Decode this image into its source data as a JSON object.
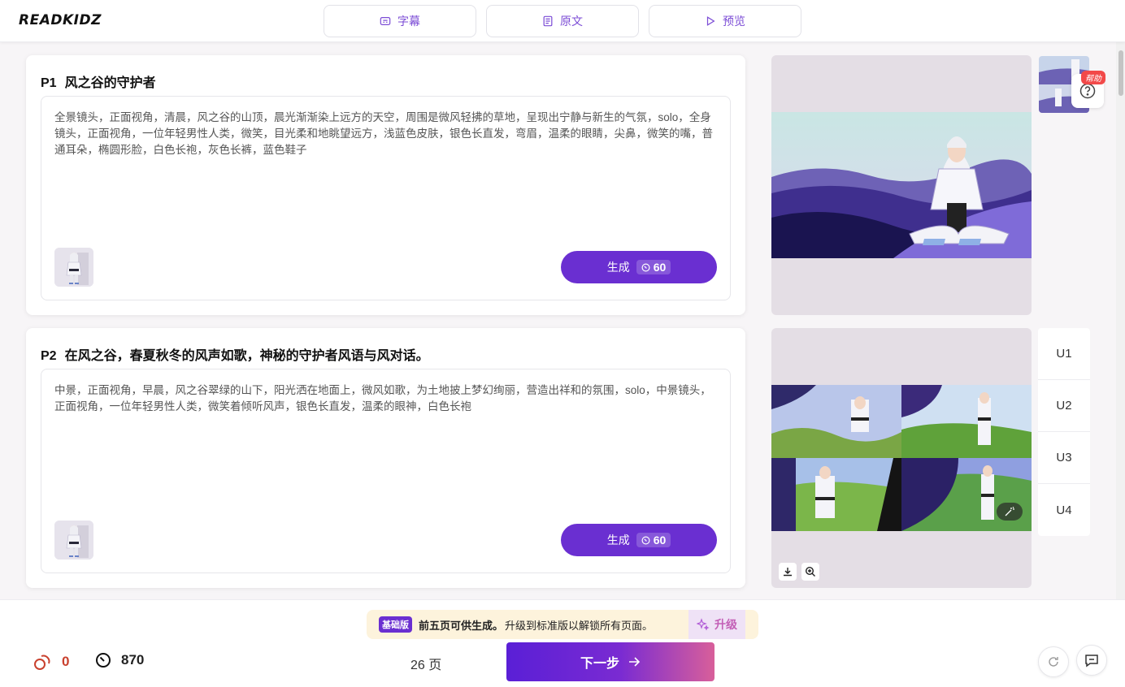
{
  "header": {
    "logo": "READKIDZ",
    "tabs": [
      {
        "label": "字幕",
        "icon": "subtitles-icon"
      },
      {
        "label": "原文",
        "icon": "document-icon"
      },
      {
        "label": "预览",
        "icon": "play-icon"
      }
    ]
  },
  "pages": [
    {
      "number": "P1",
      "title": "风之谷的守护者",
      "prompt": "全景镜头，正面视角，清晨，风之谷的山顶，晨光渐渐染上远方的天空，周围是微风轻拂的草地，呈现出宁静与新生的气氛，solo，全身镜头，正面视角，一位年轻男性人类，微笑，目光柔和地眺望远方，浅蓝色皮肤，银色长直发，弯眉，温柔的眼睛，尖鼻，微笑的嘴，普通耳朵，椭圆形脸，白色长袍，灰色长裤，蓝色鞋子",
      "generate_label": "生成",
      "cost": "60"
    },
    {
      "number": "P2",
      "title": "在风之谷，春夏秋冬的风声如歌，神秘的守护者风语与风对话。",
      "prompt": "中景，正面视角，早晨，风之谷翠绿的山下，阳光洒在地面上，微风如歌，为土地披上梦幻绚丽，营造出祥和的氛围，solo，中景镜头，正面视角，一位年轻男性人类，微笑着倾听风声，银色长直发，温柔的眼神，白色长袍",
      "generate_label": "生成",
      "cost": "60"
    }
  ],
  "side": {
    "help_badge": "帮助",
    "variations": [
      "U1",
      "U2",
      "U3",
      "U4"
    ]
  },
  "footer": {
    "notice_badge": "基础版",
    "notice_bold": "前五页可供生成。",
    "notice_text": "升级到标准版以解锁所有页面。",
    "upgrade_label": "升级",
    "stat_a": "0",
    "stat_b": "870",
    "page_count": "26 页",
    "next_label": "下一步"
  },
  "colors": {
    "primary": "#6a2fd1",
    "accent_pink": "#c35fb6",
    "notice_bg": "#fdf3dc"
  }
}
